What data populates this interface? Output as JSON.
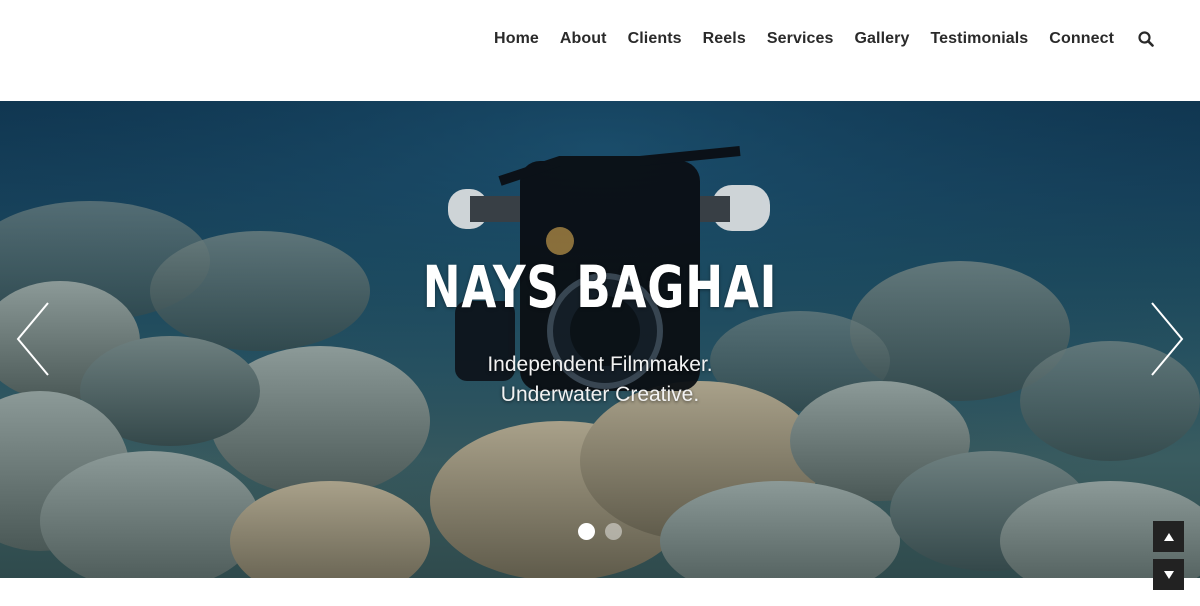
{
  "nav": {
    "items": [
      {
        "label": "Home"
      },
      {
        "label": "About"
      },
      {
        "label": "Clients"
      },
      {
        "label": "Reels"
      },
      {
        "label": "Services"
      },
      {
        "label": "Gallery"
      },
      {
        "label": "Testimonials"
      },
      {
        "label": "Connect"
      }
    ],
    "search_icon": "search-icon"
  },
  "hero": {
    "title": "NAYS BAGHAI",
    "subtitle_line1": "Independent Filmmaker.",
    "subtitle_line2": "Underwater Creative.",
    "prev_icon": "chevron-left-icon",
    "next_icon": "chevron-right-icon",
    "slides": {
      "total": 2,
      "active": 1
    }
  },
  "scroll_controls": {
    "up_icon": "triangle-up-icon",
    "down_icon": "triangle-down-icon"
  },
  "colors": {
    "nav_text": "#2a2a2a",
    "header_bg": "#ffffff",
    "hero_text": "#ffffff",
    "scroll_btn_bg": "#222222"
  }
}
